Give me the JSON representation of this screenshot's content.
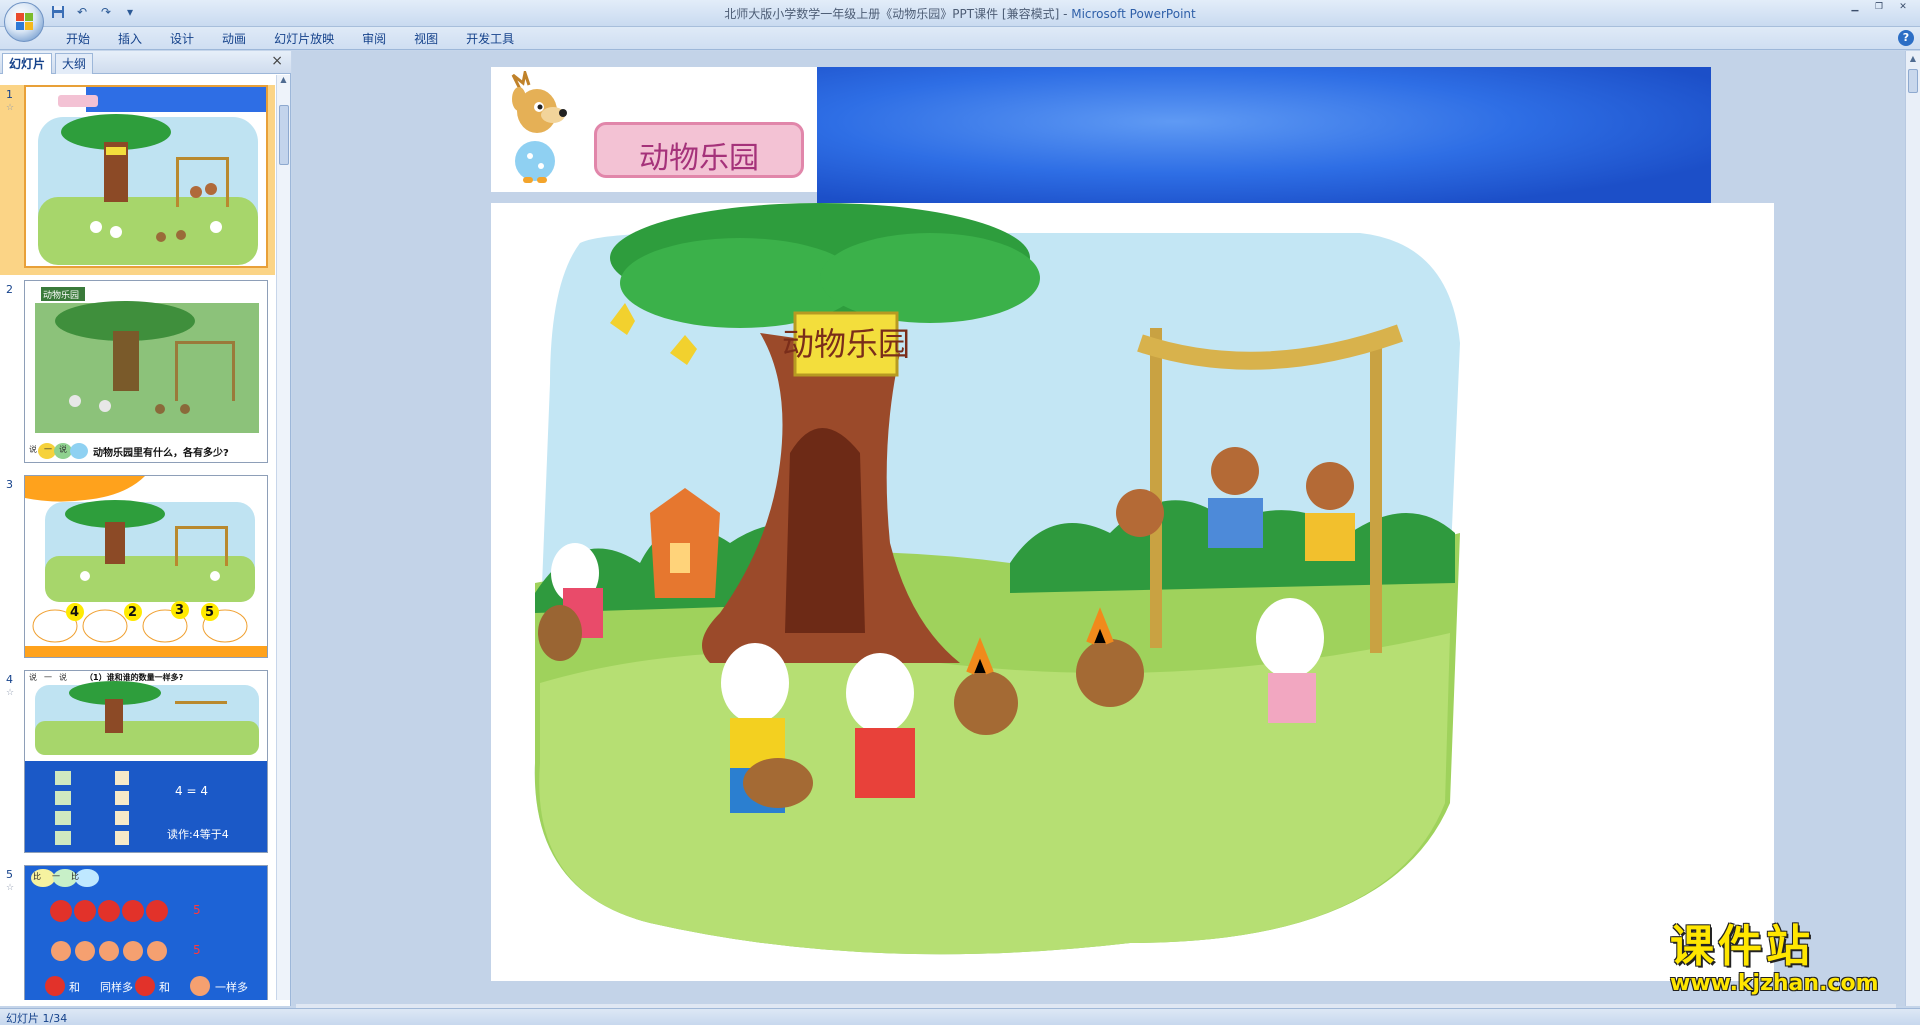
{
  "window": {
    "title_doc": "北师大版小学数学一年级上册《动物乐园》PPT课件 [兼容模式] - ",
    "title_app": "Microsoft PowerPoint"
  },
  "ribbon": {
    "tabs": [
      "开始",
      "插入",
      "设计",
      "动画",
      "幻灯片放映",
      "审阅",
      "视图",
      "开发工具"
    ]
  },
  "left_panel": {
    "tab_slides": "幻灯片",
    "tab_outline": "大纲",
    "close": "×",
    "slides": [
      {
        "num": "1",
        "selected": true
      },
      {
        "num": "2",
        "tag": "动物乐园",
        "caption": "动物乐园里有什么，各有多少?",
        "badge": [
          "说",
          "一",
          "说"
        ]
      },
      {
        "num": "3",
        "counts": [
          "4",
          "2",
          "3",
          "5"
        ]
      },
      {
        "num": "4",
        "caption": "（1）谁和谁的数量一样多?",
        "badge": [
          "说",
          "一",
          "说"
        ],
        "eq": "4 = 4",
        "read": "读作:4等于4"
      },
      {
        "num": "5",
        "badge": [
          "比",
          "一",
          "比"
        ],
        "count": "5",
        "count2": "5",
        "line1": "和",
        "line2": "同样多",
        "line3": "和",
        "line4": "一样多"
      }
    ]
  },
  "slide": {
    "title": "动物乐园",
    "sign": "动物乐园"
  },
  "watermark": {
    "main": "课件站",
    "url": "www.kjzhan.com"
  },
  "status": {
    "slide_info": "幻灯片 1/34"
  }
}
